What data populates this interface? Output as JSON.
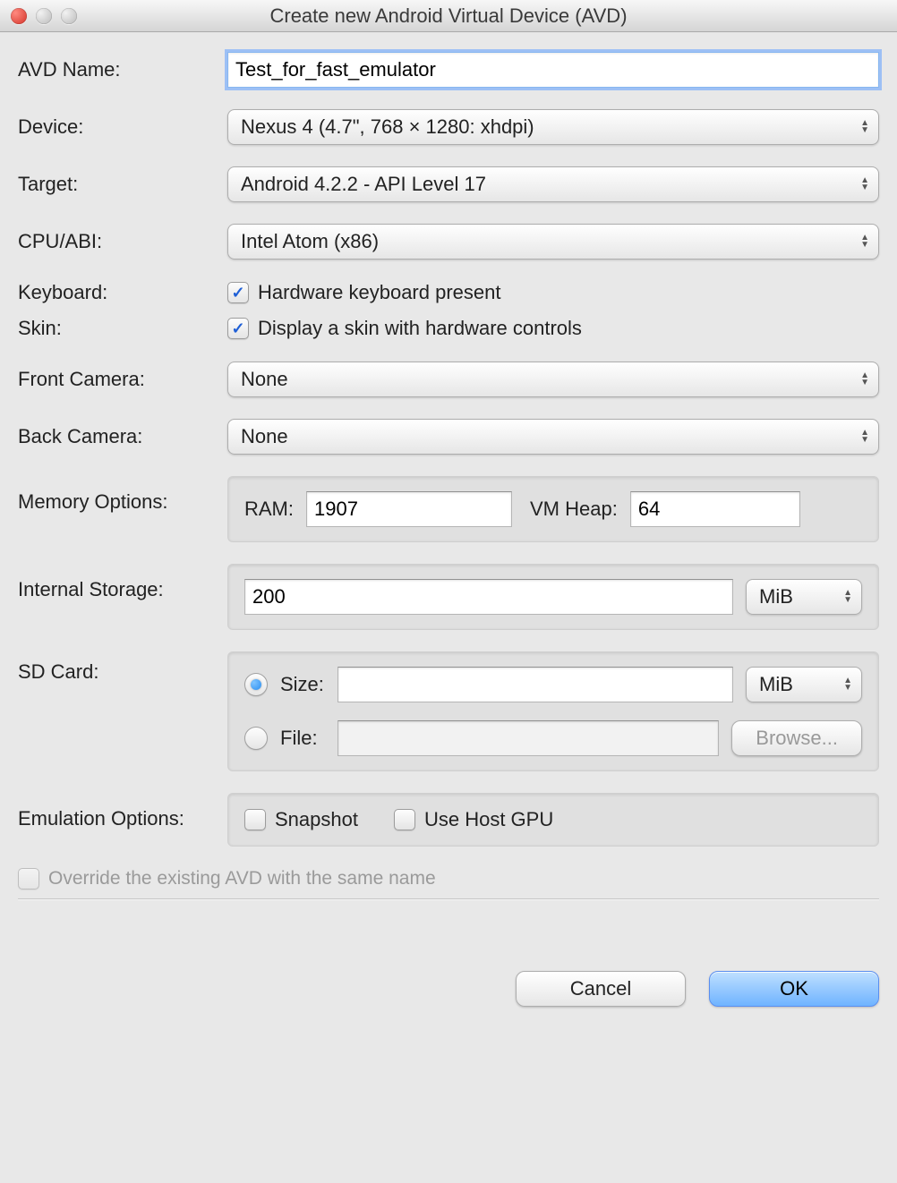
{
  "window": {
    "title": "Create new Android Virtual Device (AVD)"
  },
  "labels": {
    "avd_name": "AVD Name:",
    "device": "Device:",
    "target": "Target:",
    "cpu_abi": "CPU/ABI:",
    "keyboard": "Keyboard:",
    "skin": "Skin:",
    "front_camera": "Front Camera:",
    "back_camera": "Back Camera:",
    "memory_options": "Memory Options:",
    "internal_storage": "Internal Storage:",
    "sd_card": "SD Card:",
    "emulation_options": "Emulation Options:"
  },
  "fields": {
    "avd_name": "Test_for_fast_emulator",
    "device": "Nexus 4 (4.7\", 768 × 1280: xhdpi)",
    "target": "Android 4.2.2 - API Level 17",
    "cpu_abi": "Intel Atom (x86)",
    "front_camera": "None",
    "back_camera": "None"
  },
  "keyboard": {
    "label": "Hardware keyboard present",
    "checked": true
  },
  "skin": {
    "label": "Display a skin with hardware controls",
    "checked": true
  },
  "memory": {
    "ram_label": "RAM:",
    "ram_value": "1907",
    "heap_label": "VM Heap:",
    "heap_value": "64"
  },
  "internal_storage": {
    "value": "200",
    "unit": "MiB"
  },
  "sd_card": {
    "size_label": "Size:",
    "size_value": "",
    "size_unit": "MiB",
    "file_label": "File:",
    "file_value": "",
    "browse": "Browse...",
    "selected": "size"
  },
  "emulation": {
    "snapshot_label": "Snapshot",
    "use_host_gpu_label": "Use Host GPU",
    "snapshot_checked": false,
    "use_host_gpu_checked": false
  },
  "override": {
    "label": "Override the existing AVD with the same name",
    "checked": false,
    "enabled": false
  },
  "buttons": {
    "cancel": "Cancel",
    "ok": "OK"
  }
}
